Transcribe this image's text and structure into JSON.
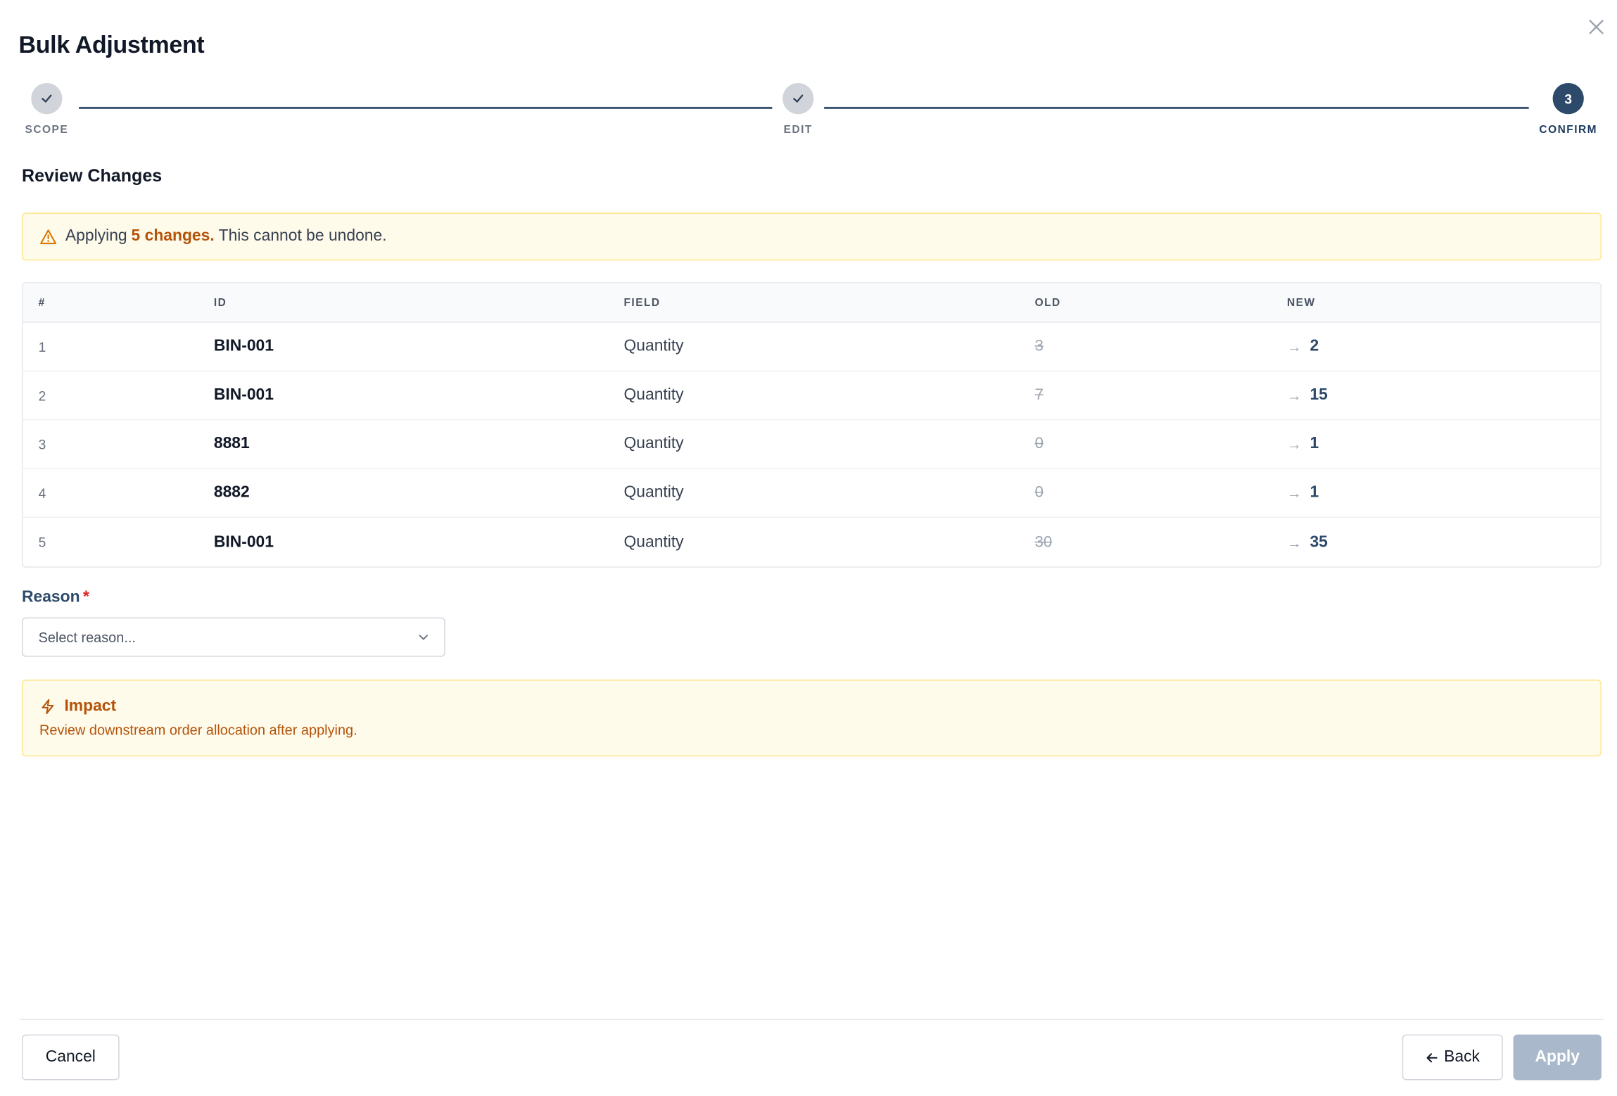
{
  "dialog": {
    "title": "Bulk Adjustment",
    "close_icon": "close-icon"
  },
  "stepper": {
    "steps": [
      {
        "label": "SCOPE",
        "state": "done",
        "icon": "check-icon"
      },
      {
        "label": "EDIT",
        "state": "done",
        "icon": "check-icon"
      },
      {
        "label": "CONFIRM",
        "state": "active",
        "number": "3"
      }
    ]
  },
  "review": {
    "title": "Review Changes",
    "warning": {
      "icon": "warning-icon",
      "prefix": "Applying",
      "highlight": "5 changes.",
      "suffix": "This cannot be undone."
    },
    "table": {
      "headers": [
        "#",
        "ID",
        "FIELD",
        "OLD",
        "NEW"
      ],
      "rows": [
        {
          "num": "1",
          "id": "BIN-001",
          "field": "Quantity",
          "old": "3",
          "new": "2"
        },
        {
          "num": "2",
          "id": "BIN-001",
          "field": "Quantity",
          "old": "7",
          "new": "15"
        },
        {
          "num": "3",
          "id": "8881",
          "field": "Quantity",
          "old": "0",
          "new": "1"
        },
        {
          "num": "4",
          "id": "8882",
          "field": "Quantity",
          "old": "0",
          "new": "1"
        },
        {
          "num": "5",
          "id": "BIN-001",
          "field": "Quantity",
          "old": "30",
          "new": "35"
        }
      ],
      "arrow": "→"
    }
  },
  "reason": {
    "label": "Reason",
    "required_mark": "*",
    "placeholder": "Select reason..."
  },
  "impact": {
    "icon": "lightning-icon",
    "title": "Impact",
    "message": "Review downstream order allocation after applying."
  },
  "footer": {
    "cancel_label": "Cancel",
    "back_label": "Back",
    "apply_label": "Apply"
  },
  "colors": {
    "accent": "#2d4a6b",
    "warning_bg": "#fffbeb",
    "warning_text": "#b45309",
    "apply_disabled": "#a9b9cb"
  }
}
